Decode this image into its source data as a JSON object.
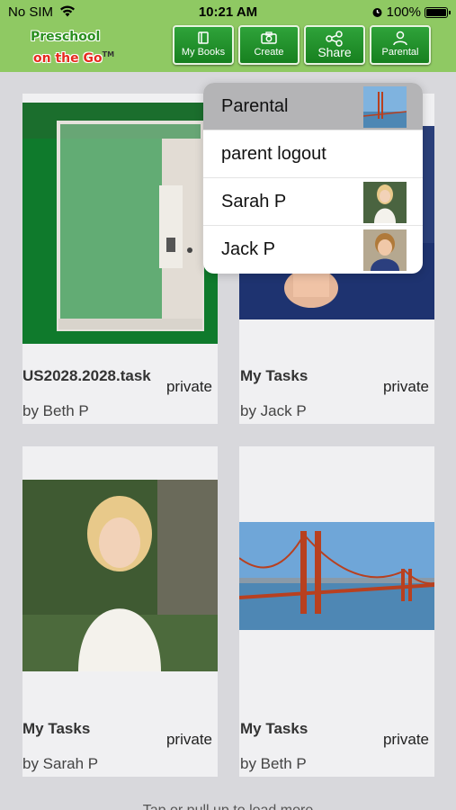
{
  "status_bar": {
    "carrier": "No SIM",
    "time": "10:21 AM",
    "battery": "100%"
  },
  "header": {
    "logo_line1": "Preschool",
    "logo_line2": "on the Go",
    "logo_tm": "TM",
    "buttons": [
      {
        "label": "My Books",
        "icon": "book-icon"
      },
      {
        "label": "Create",
        "icon": "camera-icon"
      },
      {
        "label": "Share",
        "icon": "share-icon"
      },
      {
        "label": "Parental",
        "icon": "person-icon"
      }
    ]
  },
  "cards": [
    {
      "title": "US2028.2028.task",
      "privacy": "private",
      "author": "by Beth P"
    },
    {
      "title": "My Tasks",
      "privacy": "private",
      "author": "by Jack P"
    },
    {
      "title": "My Tasks",
      "privacy": "private",
      "author": "by Sarah P"
    },
    {
      "title": "My Tasks",
      "privacy": "private",
      "author": "by Beth P"
    }
  ],
  "menu": {
    "items": [
      {
        "label": "Parental",
        "selected": true
      },
      {
        "label": "parent logout"
      },
      {
        "label": "Sarah P"
      },
      {
        "label": "Jack P"
      }
    ]
  },
  "footer": {
    "load_more": "Tap or pull up to load more"
  },
  "colors": {
    "header_bg": "#8fc963",
    "button_green": "#1f8f2a",
    "background": "#d8d8dc"
  }
}
